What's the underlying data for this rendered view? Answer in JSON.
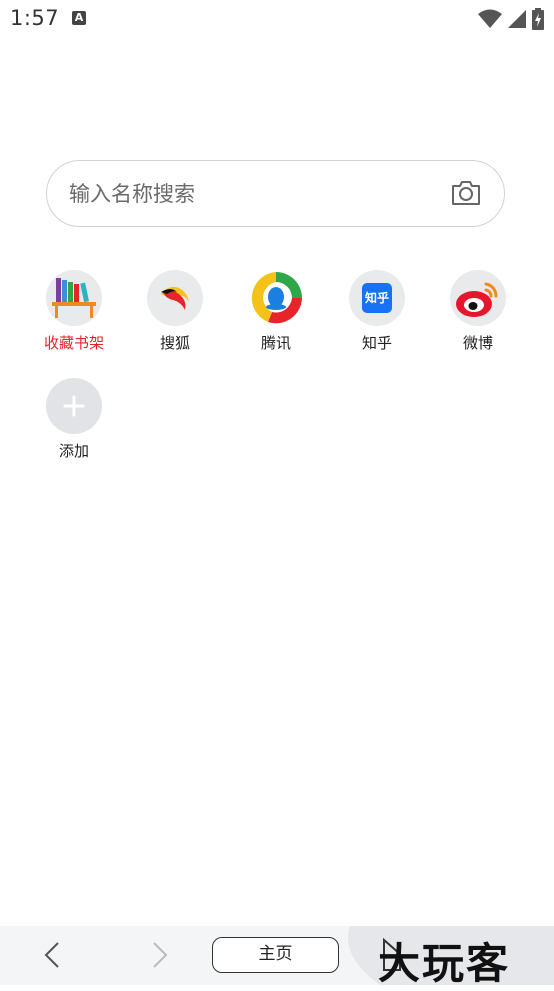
{
  "status_bar": {
    "time": "1:57",
    "notification_badge": "A"
  },
  "search": {
    "placeholder": "输入名称搜索",
    "camera_icon": "camera-icon"
  },
  "quick_links": [
    {
      "label": "收藏书架",
      "icon": "bookshelf-icon",
      "label_color": "#e8242b"
    },
    {
      "label": "搜狐",
      "icon": "sohu-icon"
    },
    {
      "label": "腾讯",
      "icon": "tencent-icon"
    },
    {
      "label": "知乎",
      "icon": "zhihu-icon",
      "icon_text": "知乎"
    },
    {
      "label": "微博",
      "icon": "weibo-icon"
    },
    {
      "label": "添加",
      "icon": "plus-icon"
    }
  ],
  "bottom_bar": {
    "home_label": "主页",
    "watermark": "大玩客"
  }
}
